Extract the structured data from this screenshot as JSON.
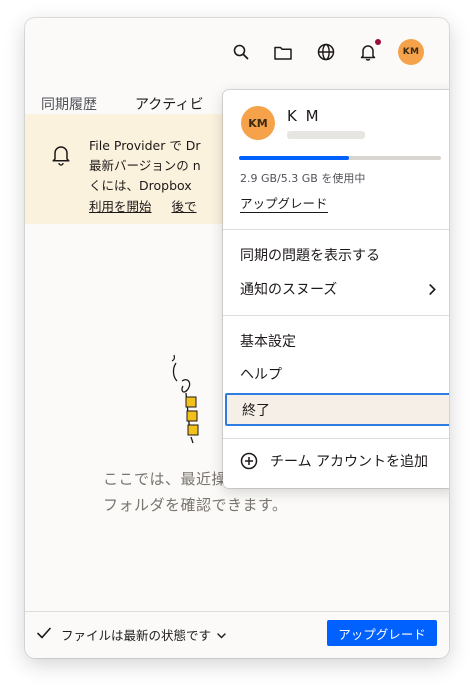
{
  "topbar": {
    "icons": [
      "search-icon",
      "folder-icon",
      "globe-icon",
      "bell-icon"
    ],
    "avatar_initials": "KM",
    "notification_dot_color": "#9b0a3c",
    "avatar_color": "#f6a24b"
  },
  "tabs": [
    {
      "label": "同期履歴",
      "active": false
    },
    {
      "label": "アクティビ",
      "active": true
    }
  ],
  "banner": {
    "line1": "File Provider で Dr",
    "line2": "最新バージョンの n",
    "line3": "くには、Dropbox",
    "link_start": "利用を開始",
    "link_later": "後で"
  },
  "empty_state": {
    "line1": "ここでは、最近操作したファイルや",
    "line2": "フォルダを確認できます。"
  },
  "footer": {
    "status": "ファイルは最新の状態です",
    "upgrade_button": "アップグレード",
    "accent_color": "#0061fe"
  },
  "menu": {
    "avatar_initials": "KM",
    "name": "K M",
    "storage_text": "2.9 GB/5.3 GB を使用中",
    "storage_used_fraction": 0.547,
    "upgrade_link": "アップグレード",
    "items": [
      {
        "label": "同期の問題を表示する"
      },
      {
        "label": "通知のスヌーズ",
        "submenu": true
      },
      {
        "label": "基本設定"
      },
      {
        "label": "ヘルプ"
      },
      {
        "label": "終了",
        "focused": true
      },
      {
        "label": "チーム アカウントを追加",
        "icon": "plus-circle-icon"
      }
    ]
  }
}
